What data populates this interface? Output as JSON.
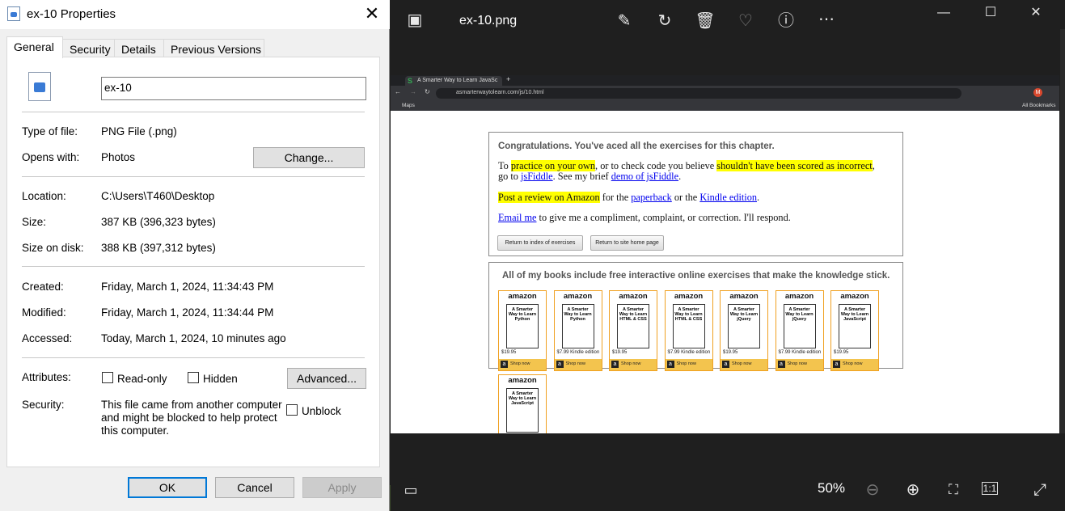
{
  "properties": {
    "title": "ex-10 Properties",
    "tabs": [
      "General",
      "Security",
      "Details",
      "Previous Versions"
    ],
    "file_name": "ex-10",
    "type_label": "Type of file:",
    "type_value": "PNG File (.png)",
    "opens_label": "Opens with:",
    "opens_value": "Photos",
    "change_button": "Change...",
    "location_label": "Location:",
    "location_value": "C:\\Users\\T460\\Desktop",
    "size_label": "Size:",
    "size_value": "387 KB (396,323 bytes)",
    "size_disk_label": "Size on disk:",
    "size_disk_value": "388 KB (397,312 bytes)",
    "created_label": "Created:",
    "created_value": "Friday, March 1, 2024, 11:34:43 PM",
    "modified_label": "Modified:",
    "modified_value": "Friday, March 1, 2024, 11:34:44 PM",
    "accessed_label": "Accessed:",
    "accessed_value": "Today, March 1, 2024, 10 minutes ago",
    "attributes_label": "Attributes:",
    "readonly_label": "Read-only",
    "hidden_label": "Hidden",
    "advanced_button": "Advanced...",
    "security_label": "Security:",
    "security_line1": "This file came from another computer",
    "security_line2": "and might be blocked to help protect",
    "security_line3": "this computer.",
    "unblock_label": "Unblock",
    "ok": "OK",
    "cancel": "Cancel",
    "apply": "Apply"
  },
  "viewer": {
    "file_name": "ex-10.png",
    "zoom": "50%",
    "icons": [
      "gallery-icon",
      "edit-icon",
      "rotate-icon",
      "delete-icon",
      "favorite-icon",
      "info-icon",
      "more-icon",
      "minimize-icon",
      "maximize-icon",
      "close-icon",
      "filmstrip-icon",
      "zoom-out-icon",
      "zoom-in-icon",
      "fit-icon",
      "actual-size-icon",
      "fullscreen-icon"
    ]
  },
  "browser": {
    "tab_title": "A Smarter Way to Learn JavaSc",
    "url": "asmarterwaytolearn.com/js/10.html",
    "bookmark": "Maps",
    "all_bookmarks": "All Bookmarks",
    "profile_initial": "M"
  },
  "page": {
    "congrats": "Congratulations. You've aced all the exercises for this chapter.",
    "p1_a": "To ",
    "p1_link1": "practice on your own",
    "p1_b": ", or to check code you believe ",
    "p1_link2": "shouldn't have been scored as incorrect",
    "p1_c": ",",
    "p2_a": "go to ",
    "p2_link1": "jsFiddle",
    "p2_b": ". See my brief ",
    "p2_link2": "demo of jsFiddle",
    "p2_c": ".",
    "p3_link1": "Post a review on Amazon",
    "p3_a": " for the ",
    "p3_link2": "paperback",
    "p3_b": " or the ",
    "p3_link3": "Kindle edition",
    "p3_c": ".",
    "p4_link": "Email me",
    "p4_a": " to give me a compliment, complaint, or correction. I'll respond.",
    "btn_index": "Return to index of exercises",
    "btn_home": "Return to site home page",
    "books_heading": "All of my books include free interactive online exercises that make the knowledge stick.",
    "amazon": "amazon",
    "shop_now": "Shop now",
    "books": [
      {
        "title": "A Smarter Way to Learn Python",
        "price": "$19.95"
      },
      {
        "title": "A Smarter Way to Learn Python",
        "price": "$7.99 Kindle edition"
      },
      {
        "title": "A Smarter Way to Learn HTML & CSS",
        "price": "$19.95"
      },
      {
        "title": "A Smarter Way to Learn HTML & CSS",
        "price": "$7.99 Kindle edition"
      },
      {
        "title": "A Smarter Way to Learn jQuery",
        "price": "$19.95"
      },
      {
        "title": "A Smarter Way to Learn jQuery",
        "price": "$7.99 Kindle edition"
      },
      {
        "title": "A Smarter Way to Learn JavaScript",
        "price": "$19.95"
      },
      {
        "title": "A Smarter Way to Learn JavaScript",
        "price": ""
      }
    ]
  }
}
